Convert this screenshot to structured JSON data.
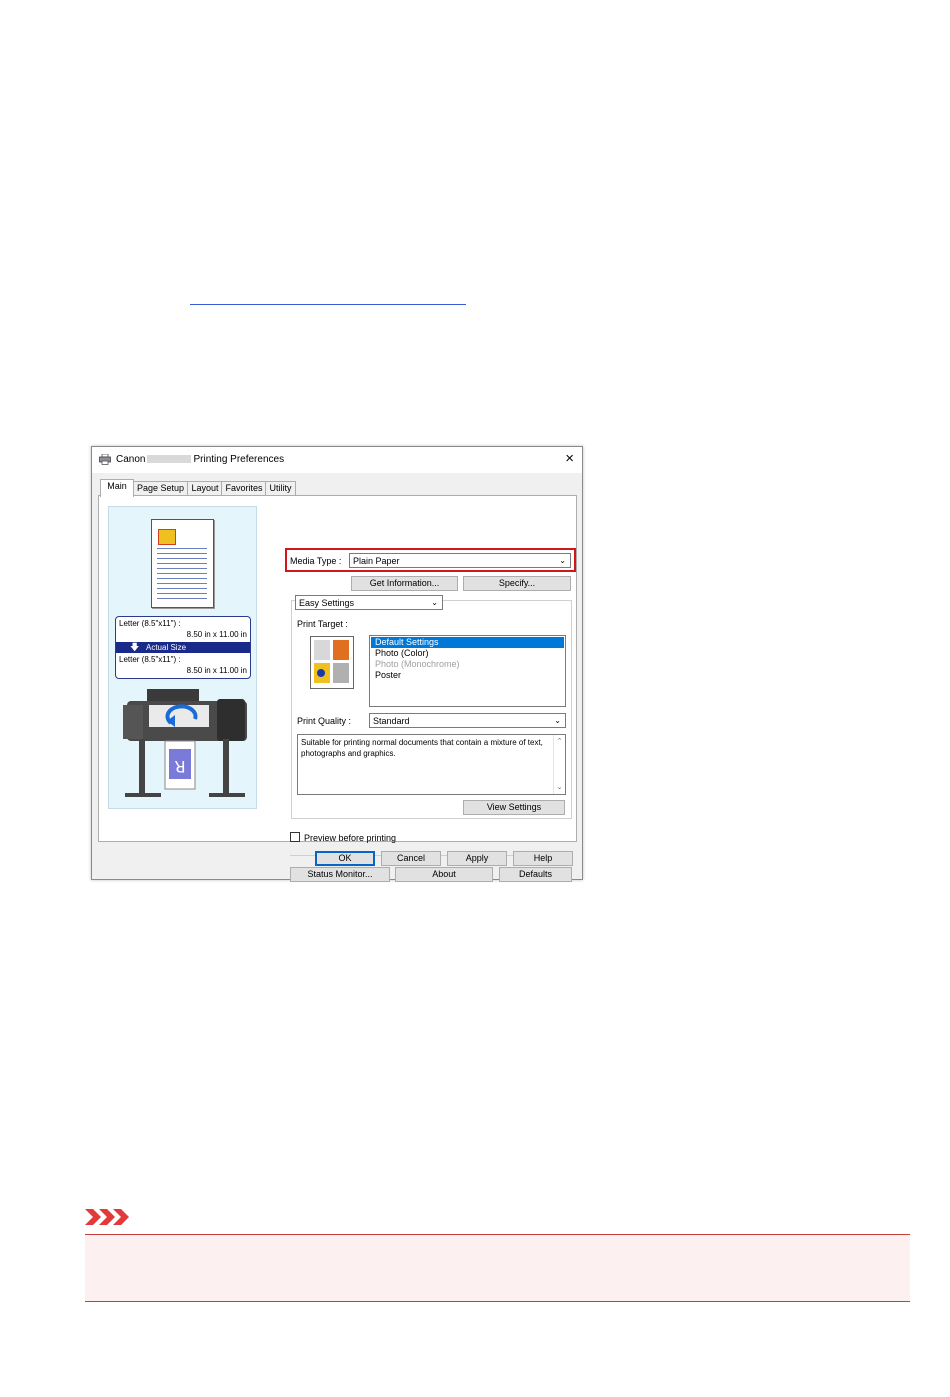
{
  "dialog": {
    "title_pre": "Canon",
    "title_post": "Printing Preferences",
    "close": "×",
    "tabs": [
      "Main",
      "Page Setup",
      "Layout",
      "Favorites",
      "Utility"
    ],
    "preview": {
      "size_top_label": "Letter (8.5\"x11\") :",
      "size_top_value": "8.50 in x 11.00 in",
      "actual_size": "Actual Size",
      "size_bottom_label": "Letter (8.5\"x11\") :",
      "size_bottom_value": "8.50 in x 11.00 in"
    },
    "media_type_label": "Media Type :",
    "media_type_value": "Plain Paper",
    "get_information": "Get Information...",
    "specify": "Specify...",
    "easy_settings": "Easy Settings",
    "print_target_label": "Print Target :",
    "print_target_items": [
      "Default Settings",
      "Photo (Color)",
      "Photo (Monochrome)",
      "Poster"
    ],
    "print_quality_label": "Print Quality :",
    "print_quality_value": "Standard",
    "description": "Suitable for printing normal documents that contain a mixture of text, photographs and graphics.",
    "view_settings": "View Settings",
    "preview_before_printing": "Preview before printing",
    "status_monitor": "Status Monitor...",
    "about": "About",
    "defaults": "Defaults",
    "ok": "OK",
    "cancel": "Cancel",
    "apply": "Apply",
    "help": "Help"
  },
  "colors": {
    "highlight": "#d01818",
    "selection": "#0078d7",
    "warning": "#c73b3b"
  }
}
